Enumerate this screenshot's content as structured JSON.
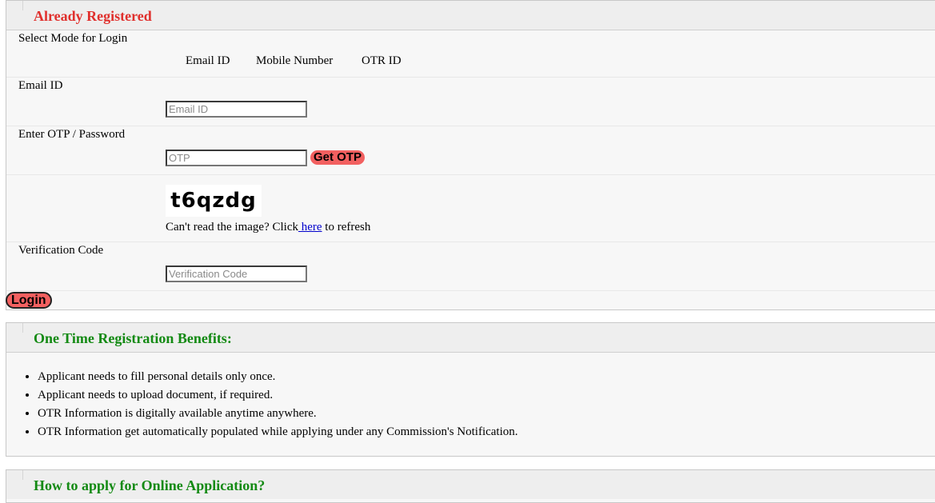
{
  "login_section": {
    "title": "Already Registered",
    "select_mode_label": "Select Mode for Login",
    "modes": [
      "Email ID",
      "Mobile Number",
      "OTR ID"
    ],
    "email_label": "Email ID",
    "email_placeholder": "Email ID",
    "email_value": "",
    "otp_label": "Enter OTP / Password",
    "otp_placeholder": "OTP",
    "otp_value": "",
    "get_otp_label": "Get OTP",
    "captcha_text": "t6qzdg",
    "refresh_prefix": "Can't read the image? Click",
    "refresh_link": " here",
    "refresh_suffix": " to refresh",
    "verification_label": "Verification Code",
    "verification_placeholder": "Verification Code",
    "verification_value": "",
    "login_label": "Login"
  },
  "benefits_section": {
    "title": "One Time Registration Benefits:",
    "items": [
      "Applicant needs to fill personal details only once.",
      "Applicant needs to upload document, if required.",
      "OTR Information is digitally available anytime anywhere.",
      "OTR Information get automatically populated while applying under any Commission's Notification."
    ]
  },
  "howto_section": {
    "title": "How to apply for Online Application?"
  },
  "colors": {
    "login_title": "#e0302d",
    "section_title": "#138a13",
    "button_bg": "#f26060",
    "link": "#0000cc"
  }
}
